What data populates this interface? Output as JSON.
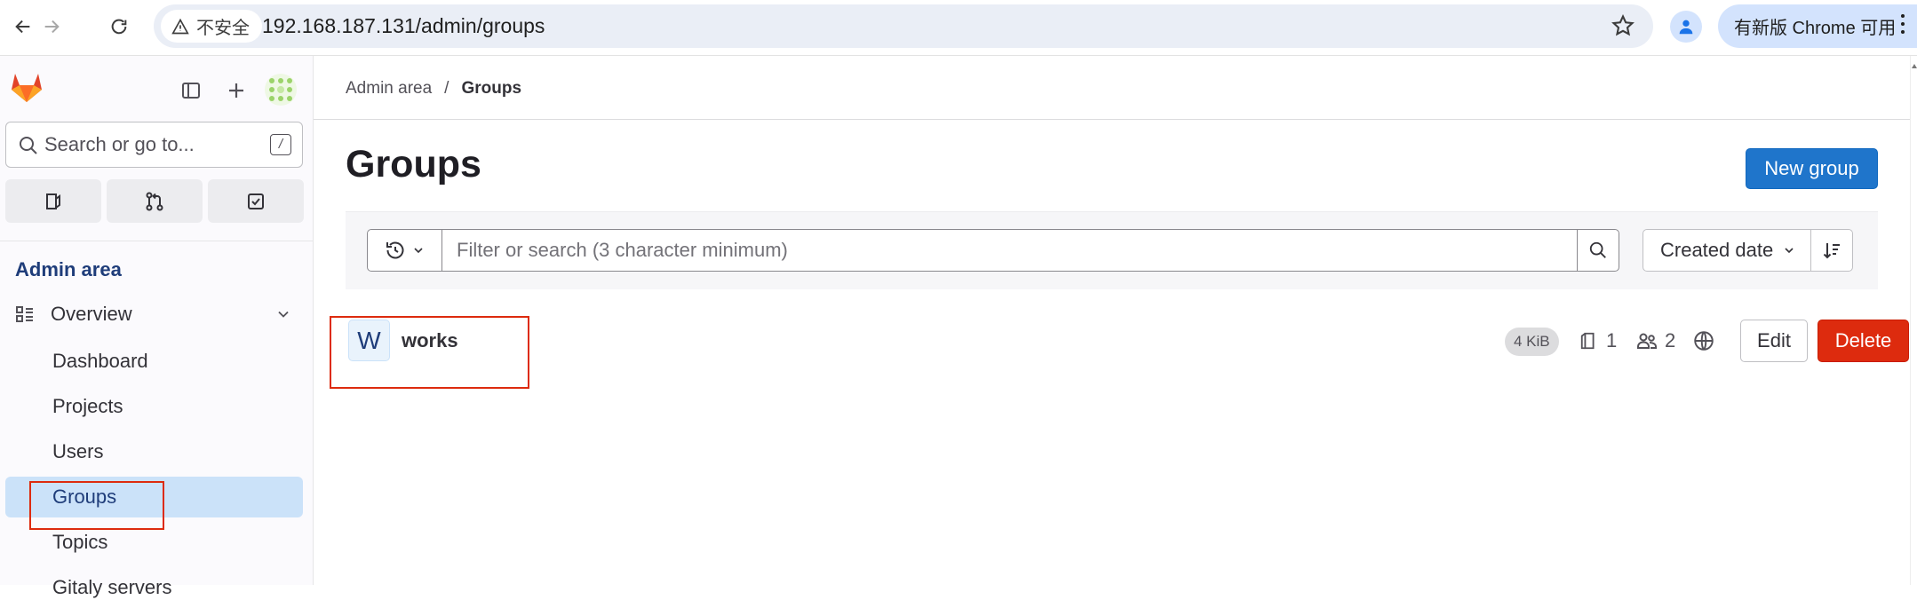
{
  "browser": {
    "insecure_label": "不安全",
    "url": "192.168.187.131/admin/groups",
    "update_label": "有新版 Chrome 可用"
  },
  "sidebar": {
    "search_placeholder": "Search or go to...",
    "search_shortcut": "/",
    "section_title": "Admin area",
    "overview_label": "Overview",
    "items": [
      {
        "label": "Dashboard"
      },
      {
        "label": "Projects"
      },
      {
        "label": "Users"
      },
      {
        "label": "Groups",
        "active": true
      },
      {
        "label": "Topics"
      },
      {
        "label": "Gitaly servers"
      }
    ]
  },
  "breadcrumb": {
    "root": "Admin area",
    "separator": "/",
    "current": "Groups"
  },
  "page": {
    "title": "Groups",
    "new_group_label": "New group"
  },
  "filter": {
    "placeholder": "Filter or search (3 character minimum)",
    "sort_label": "Created date"
  },
  "groups": [
    {
      "avatar_letter": "W",
      "name": "works",
      "storage": "4 KiB",
      "subgroups": "1",
      "members": "2",
      "visibility_icon": "globe-icon",
      "edit_label": "Edit",
      "delete_label": "Delete"
    }
  ],
  "colors": {
    "primary": "#1f75cb",
    "danger": "#dd2b0e",
    "active_nav": "#cbe2f9",
    "highlight_box": "#dd2b0e"
  }
}
